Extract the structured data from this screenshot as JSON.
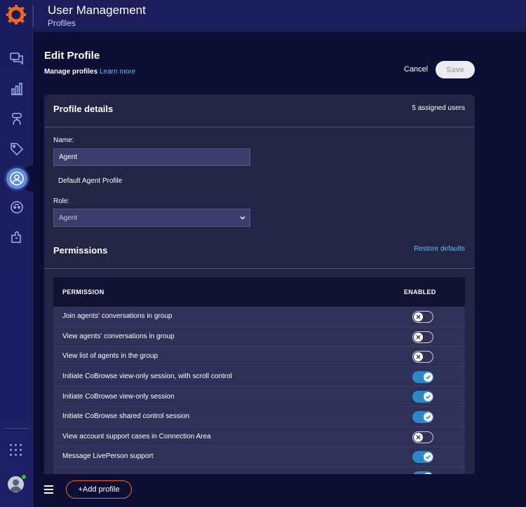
{
  "header": {
    "title": "User Management",
    "subtitle": "Profiles"
  },
  "sidebar": {
    "items": [
      {
        "icon": "conversations-icon"
      },
      {
        "icon": "analytics-icon"
      },
      {
        "icon": "bot-icon"
      },
      {
        "icon": "tag-icon"
      },
      {
        "icon": "users-icon",
        "active": true
      },
      {
        "icon": "automation-icon"
      },
      {
        "icon": "integrations-icon"
      }
    ],
    "apps_icon": "apps-grid-icon",
    "status_color": "#2fbf3a"
  },
  "page": {
    "title": "Edit Profile",
    "manage_text": "Manage profiles",
    "learn_more": "Learn more",
    "cancel_label": "Cancel",
    "save_label": "Save"
  },
  "profile": {
    "section_title": "Profile details",
    "assigned_users": "5 assigned users",
    "name_label": "Name:",
    "name_value": "Agent",
    "description": "Default Agent Profile",
    "role_label": "Role:",
    "role_value": "Agent"
  },
  "permissions": {
    "section_title": "Permissions",
    "restore_label": "Restore defaults",
    "columns": [
      "PERMISSION",
      "ENABLED"
    ],
    "rows": [
      {
        "label": "Join agents' conversations in group",
        "enabled": false
      },
      {
        "label": "View agents' conversations in group",
        "enabled": false
      },
      {
        "label": "View list of agents in the group",
        "enabled": false
      },
      {
        "label": "Initiate CoBrowse view-only session, with scroll control",
        "enabled": true
      },
      {
        "label": "Initiate CoBrowse view-only session",
        "enabled": true
      },
      {
        "label": "Initiate CoBrowse shared control session",
        "enabled": true
      },
      {
        "label": "View account support cases in Connection Area",
        "enabled": false
      },
      {
        "label": "Message LivePerson support",
        "enabled": true
      },
      {
        "label": "",
        "enabled": true
      }
    ]
  },
  "footer": {
    "add_profile_label": "+Add profile"
  },
  "colors": {
    "accent": "#f06a1e",
    "link": "#5ec4f0",
    "toggle_on": "#2b89c9"
  }
}
